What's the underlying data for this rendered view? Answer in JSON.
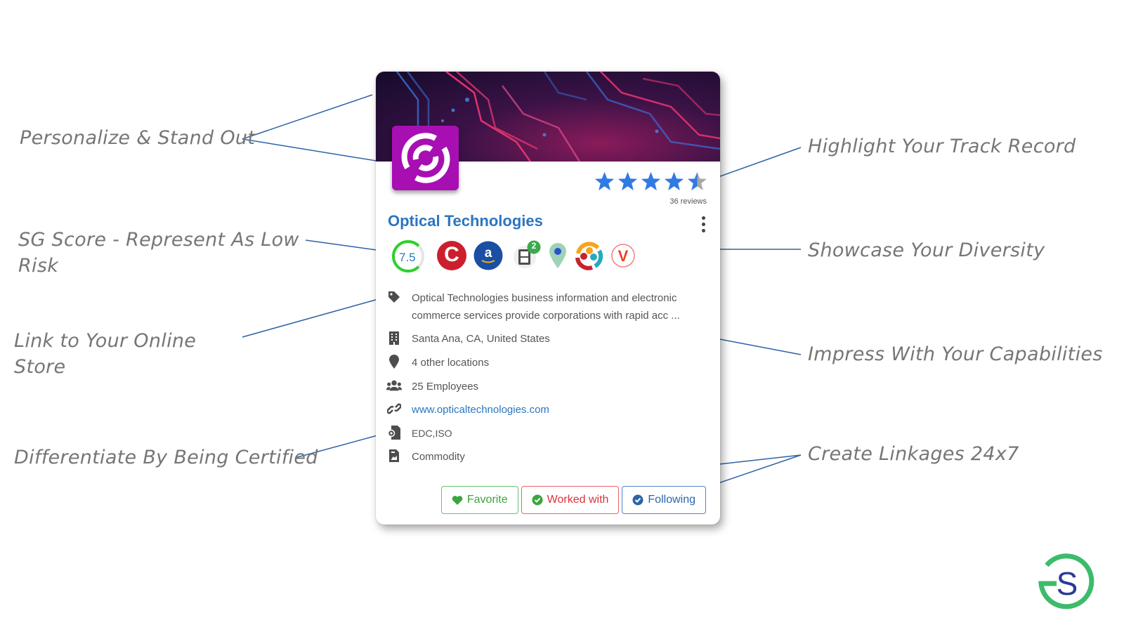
{
  "annotations": {
    "left": [
      {
        "text": "Personalize & Stand Out"
      },
      {
        "text": "SG Score - Represent As Low Risk"
      },
      {
        "text": "Link to Your Online Store"
      },
      {
        "text": "Differentiate By Being Certified"
      }
    ],
    "right": [
      {
        "text": "Highlight Your Track Record"
      },
      {
        "text": "Showcase Your Diversity"
      },
      {
        "text": "Impress With Your Capabilities"
      },
      {
        "text": "Create Linkages 24x7"
      }
    ]
  },
  "card": {
    "company_name": "Optical Technologies",
    "rating": {
      "value": 4.5,
      "max": 5,
      "reviews_label": "36 reviews"
    },
    "sg_score": {
      "value": "7.5",
      "fraction": 0.75
    },
    "badges": [
      {
        "name": "cage-code",
        "glyph": "C"
      },
      {
        "name": "amazon",
        "glyph": "a"
      },
      {
        "name": "filing-cabinet",
        "count": "2"
      },
      {
        "name": "location-pin"
      },
      {
        "name": "diversity"
      },
      {
        "name": "veteran",
        "glyph": "V"
      }
    ],
    "description": "Optical Technologies business information and electronic commerce services provide corporations with rapid acc ...",
    "location": "Santa Ana, CA, United States",
    "other_locations": "4 other locations",
    "employees": "25 Employees",
    "website": "www.opticaltechnologies.com",
    "certifications": "EDC,ISO",
    "commodity": "Commodity",
    "buttons": {
      "favorite": "Favorite",
      "worked_with": "Worked with",
      "following": "Following"
    }
  },
  "colors": {
    "accent_blue": "#2a76c0",
    "star_blue": "#2f7ae5",
    "logo_purple": "#a70fb2",
    "score_green": "#2ed12e",
    "favorite_green": "#3aa53e",
    "worked_red": "#d9333b",
    "following_blue": "#2a65a8",
    "brand_green": "#3dbb6c",
    "brand_navy": "#2b3a9a"
  }
}
